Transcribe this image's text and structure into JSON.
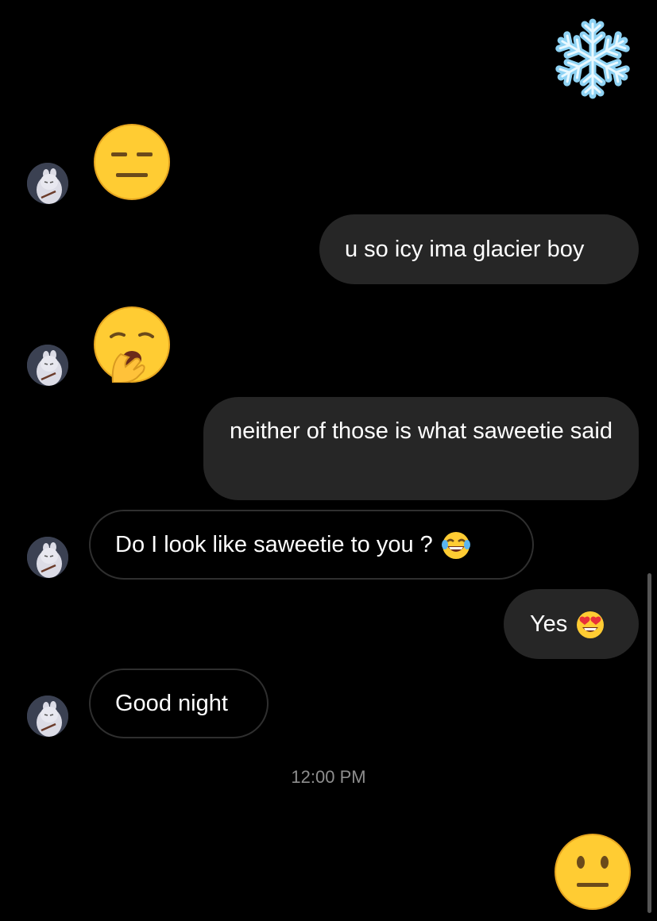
{
  "conversation": {
    "messages": [
      {
        "from": "me",
        "type": "emoji",
        "emoji": "snowflake-emoji"
      },
      {
        "from": "them",
        "type": "emoji",
        "emoji": "expressionless-face-emoji"
      },
      {
        "from": "me",
        "type": "text",
        "text": "u so icy ima glacier boy"
      },
      {
        "from": "them",
        "type": "emoji",
        "emoji": "yawning-face-emoji"
      },
      {
        "from": "me",
        "type": "text",
        "text": "neither of those is what saweetie said"
      },
      {
        "from": "them",
        "type": "text",
        "text": "Do I look like saweetie to you ?",
        "trailing_emoji": "tears-of-joy-emoji"
      },
      {
        "from": "me",
        "type": "text",
        "text": "Yes",
        "trailing_emoji": "heart-eyes-emoji"
      },
      {
        "from": "them",
        "type": "text",
        "text": "Good night"
      },
      {
        "from": "me",
        "type": "emoji",
        "emoji": "neutral-face-emoji"
      }
    ],
    "timestamp": "12:00 PM"
  },
  "colors": {
    "background": "#000000",
    "outgoing_bubble": "#262626",
    "incoming_border": "#2f2f2f",
    "timestamp_text": "#8e8e8e",
    "emoji_yellow": "#ffcc33"
  }
}
